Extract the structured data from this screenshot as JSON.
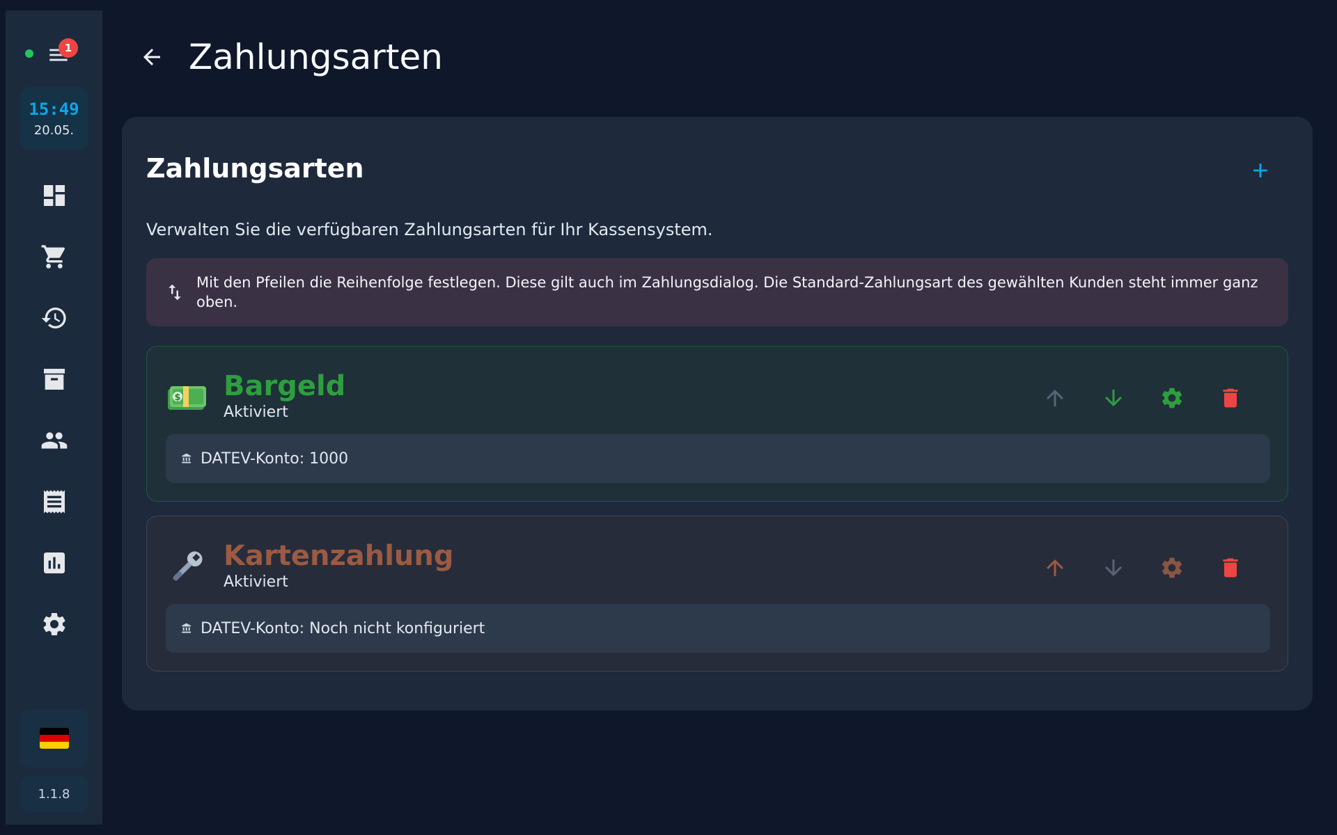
{
  "sidebar": {
    "notification_count": "1",
    "clock": {
      "time": "15:49",
      "date": "20.05."
    },
    "nav_icons": [
      "dashboard-icon",
      "cart-icon",
      "history-icon",
      "archive-icon",
      "people-icon",
      "receipt-icon",
      "chart-icon",
      "gear-icon"
    ],
    "language_icon": "germany-flag-icon",
    "version": "1.1.8"
  },
  "header": {
    "title": "Zahlungsarten"
  },
  "main": {
    "title": "Zahlungsarten",
    "subtitle": "Verwalten Sie die verfügbaren Zahlungsarten für Ihr Kassensystem.",
    "hint": "Mit den Pfeilen die Reihenfolge festlegen. Diese gilt auch im Zahlungsdialog. Die Standard-Zahlungsart des gewählten Kunden steht immer ganz oben.",
    "payment_methods": [
      {
        "name": "Bargeld",
        "status": "Aktiviert",
        "icon": "money-icon",
        "datev": "DATEV-Konto: 1000",
        "accent": "#2e9e3f"
      },
      {
        "name": "Kartenzahlung",
        "status": "Aktiviert",
        "icon": "wrench-icon",
        "datev": "DATEV-Konto: Noch nicht konfiguriert",
        "accent": "#9b5a44"
      }
    ]
  },
  "colors": {
    "accent": "#0ea5e9",
    "danger": "#ef4444",
    "success": "#22c55e"
  }
}
